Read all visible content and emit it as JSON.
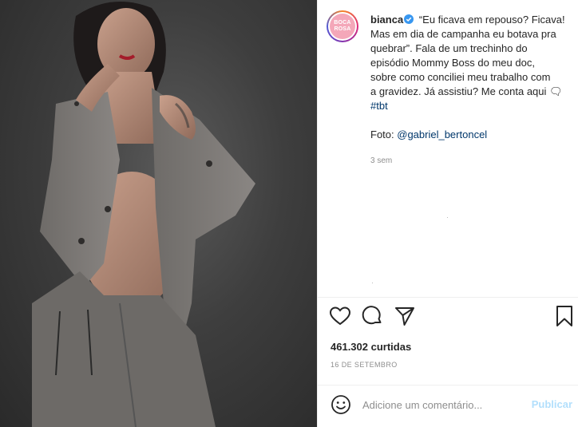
{
  "post": {
    "username": "bianca",
    "avatar_text": [
      "BOCA",
      "ROSA"
    ],
    "caption_lines": [
      "“Eu ficava em repouso? Ficava!",
      "Mas em dia de campanha eu botava pra",
      "quebrar”. Fala de um trechinho do",
      "episódio Mommy Boss do meu doc,",
      "sobre como conciliei meu trabalho com",
      "a gravidez. Já assistiu? Me conta aqui 🗨"
    ],
    "hashtag": "#tbt",
    "photo_credit_prefix": "Foto: ",
    "photo_credit_mention": "@gabriel_bertoncel",
    "time_ago": "3 sem",
    "likes": "461.302 curtidas",
    "date": "16 DE SETEMBRO"
  },
  "comment": {
    "placeholder": "Adicione um comentário...",
    "publish_label": "Publicar"
  },
  "colors": {
    "link": "#00376b",
    "muted": "#8e8e8e",
    "publish_disabled": "#b2dffc",
    "verified": "#3897f0",
    "avatar_pink": "#f4a7b9"
  },
  "icons": [
    "verified-badge-icon",
    "heart-icon",
    "comment-icon",
    "share-icon",
    "bookmark-icon",
    "emoji-icon"
  ]
}
